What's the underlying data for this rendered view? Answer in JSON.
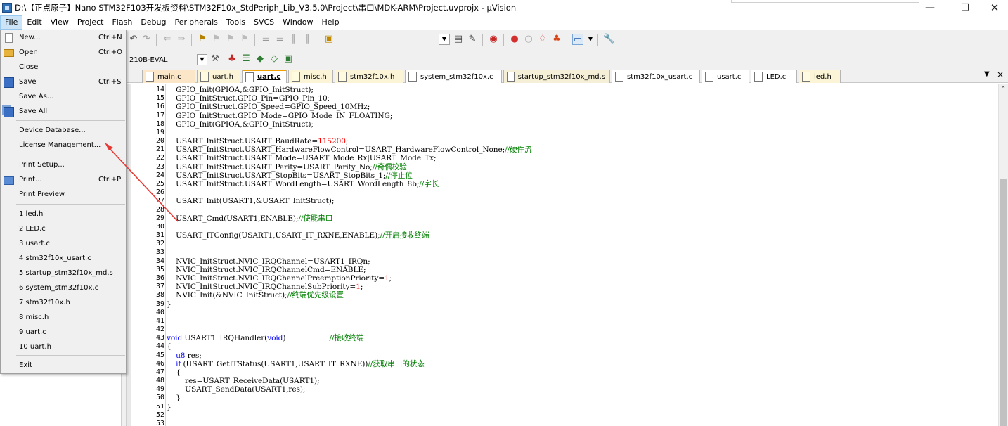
{
  "window": {
    "title": "D:\\【正点原子】Nano STM32F103开发板资料\\STM32F10x_StdPeriph_Lib_V3.5.0\\Project\\串口\\MDK-ARM\\Project.uvprojx - µVision",
    "minimize_glyph": "—",
    "maximize_glyph": "❐",
    "close_glyph": "✕"
  },
  "menubar": {
    "items": [
      "File",
      "Edit",
      "View",
      "Project",
      "Flash",
      "Debug",
      "Peripherals",
      "Tools",
      "SVCS",
      "Window",
      "Help"
    ]
  },
  "file_menu": {
    "items": [
      {
        "label": "New...",
        "shortcut": "Ctrl+N",
        "icon": "new-file-icon"
      },
      {
        "label": "Open",
        "shortcut": "Ctrl+O",
        "icon": "open-folder-icon"
      },
      {
        "label": "Close",
        "shortcut": "",
        "icon": ""
      },
      {
        "label": "Save",
        "shortcut": "Ctrl+S",
        "icon": "save-icon"
      },
      {
        "label": "Save As...",
        "shortcut": "",
        "icon": ""
      },
      {
        "label": "Save All",
        "shortcut": "",
        "icon": "save-all-icon"
      },
      {
        "label": "Device Database...",
        "shortcut": "",
        "icon": ""
      },
      {
        "label": "License Management...",
        "shortcut": "",
        "icon": ""
      },
      {
        "label": "Print Setup...",
        "shortcut": "",
        "icon": ""
      },
      {
        "label": "Print...",
        "shortcut": "Ctrl+P",
        "icon": "print-icon"
      },
      {
        "label": "Print Preview",
        "shortcut": "",
        "icon": ""
      },
      {
        "label": "1 led.h",
        "shortcut": "",
        "icon": ""
      },
      {
        "label": "2 LED.c",
        "shortcut": "",
        "icon": ""
      },
      {
        "label": "3 usart.c",
        "shortcut": "",
        "icon": ""
      },
      {
        "label": "4 stm32f10x_usart.c",
        "shortcut": "",
        "icon": ""
      },
      {
        "label": "5 startup_stm32f10x_md.s",
        "shortcut": "",
        "icon": ""
      },
      {
        "label": "6 system_stm32f10x.c",
        "shortcut": "",
        "icon": ""
      },
      {
        "label": "7 stm32f10x.h",
        "shortcut": "",
        "icon": ""
      },
      {
        "label": "8 misc.h",
        "shortcut": "",
        "icon": ""
      },
      {
        "label": "9 uart.c",
        "shortcut": "",
        "icon": ""
      },
      {
        "label": "10 uart.h",
        "shortcut": "",
        "icon": ""
      },
      {
        "label": "Exit",
        "shortcut": "",
        "icon": ""
      }
    ]
  },
  "toolbar": {
    "target": "210B-EVAL"
  },
  "tabs": [
    {
      "label": "main.c",
      "active": false
    },
    {
      "label": "uart.h",
      "active": false
    },
    {
      "label": "uart.c",
      "active": true
    },
    {
      "label": "misc.h",
      "active": false
    },
    {
      "label": "stm32f10x.h",
      "active": false
    },
    {
      "label": "system_stm32f10x.c",
      "active": false
    },
    {
      "label": "startup_stm32f10x_md.s",
      "active": false
    },
    {
      "label": "stm32f10x_usart.c",
      "active": false
    },
    {
      "label": "usart.c",
      "active": false
    },
    {
      "label": "LED.c",
      "active": false
    },
    {
      "label": "led.h",
      "active": false
    }
  ],
  "tabs_menu_glyph": "▼",
  "tabs_close_glyph": "×",
  "left_panel": {
    "fragments": [
      "/",
      "/"
    ]
  },
  "code": {
    "lines": [
      {
        "n": "14",
        "fold": "",
        "parts": [
          [
            "",
            "    GPIO_Init(GPIOA,&GPIO_InitStruct);"
          ]
        ]
      },
      {
        "n": "15",
        "fold": "",
        "parts": [
          [
            "",
            "    GPIO_InitStruct.GPIO_Pin=GPIO_Pin_10;"
          ]
        ]
      },
      {
        "n": "16",
        "fold": "",
        "parts": [
          [
            "",
            "    GPIO_InitStruct.GPIO_Speed=GPIO_Speed_10MHz;"
          ]
        ]
      },
      {
        "n": "17",
        "fold": "",
        "parts": [
          [
            "",
            "    GPIO_InitStruct.GPIO_Mode=GPIO_Mode_IN_FLOATING;"
          ]
        ]
      },
      {
        "n": "18",
        "fold": "",
        "parts": [
          [
            "",
            "    GPIO_Init(GPIOA,&GPIO_InitStruct);"
          ]
        ]
      },
      {
        "n": "19",
        "fold": "",
        "parts": [
          [
            "",
            ""
          ]
        ]
      },
      {
        "n": "20",
        "fold": "",
        "parts": [
          [
            "",
            "    USART_InitStruct.USART_BaudRate="
          ],
          [
            "num",
            "115200"
          ],
          [
            "",
            ";"
          ]
        ]
      },
      {
        "n": "21",
        "fold": "",
        "parts": [
          [
            "",
            "    USART_InitStruct.USART_HardwareFlowControl=USART_HardwareFlowControl_None;"
          ],
          [
            "cm",
            "//硬件流"
          ]
        ]
      },
      {
        "n": "22",
        "fold": "",
        "parts": [
          [
            "",
            "    USART_InitStruct.USART_Mode=USART_Mode_Rx|USART_Mode_Tx;"
          ]
        ]
      },
      {
        "n": "23",
        "fold": "",
        "parts": [
          [
            "",
            "    USART_InitStruct.USART_Parity=USART_Parity_No;"
          ],
          [
            "cm",
            "//奇偶校验"
          ]
        ]
      },
      {
        "n": "24",
        "fold": "",
        "parts": [
          [
            "",
            "    USART_InitStruct.USART_StopBits=USART_StopBits_1;"
          ],
          [
            "cm",
            "//停止位"
          ]
        ]
      },
      {
        "n": "25",
        "fold": "",
        "parts": [
          [
            "",
            "    USART_InitStruct.USART_WordLength=USART_WordLength_8b;"
          ],
          [
            "cm",
            "//字长"
          ]
        ]
      },
      {
        "n": "26",
        "fold": "",
        "parts": [
          [
            "",
            ""
          ]
        ]
      },
      {
        "n": "27",
        "fold": "",
        "parts": [
          [
            "",
            "    USART_Init(USART1,&USART_InitStruct);"
          ]
        ]
      },
      {
        "n": "28",
        "fold": "",
        "parts": [
          [
            "",
            ""
          ]
        ]
      },
      {
        "n": "29",
        "fold": "",
        "parts": [
          [
            "",
            "    USART_Cmd(USART1,ENABLE);"
          ],
          [
            "cm",
            "//使能串口"
          ]
        ]
      },
      {
        "n": "30",
        "fold": "",
        "parts": [
          [
            "",
            ""
          ]
        ]
      },
      {
        "n": "31",
        "fold": "",
        "parts": [
          [
            "",
            "    USART_ITConfig(USART1,USART_IT_RXNE,ENABLE);"
          ],
          [
            "cm",
            "//开启接收终端"
          ]
        ]
      },
      {
        "n": "32",
        "fold": "",
        "parts": [
          [
            "",
            ""
          ]
        ]
      },
      {
        "n": "33",
        "fold": "",
        "parts": [
          [
            "",
            ""
          ]
        ]
      },
      {
        "n": "34",
        "fold": "",
        "parts": [
          [
            "",
            "    NVIC_InitStruct.NVIC_IRQChannel=USART1_IRQn;"
          ]
        ]
      },
      {
        "n": "35",
        "fold": "",
        "parts": [
          [
            "",
            "    NVIC_InitStruct.NVIC_IRQChannelCmd=ENABLE;"
          ]
        ]
      },
      {
        "n": "36",
        "fold": "",
        "parts": [
          [
            "",
            "    NVIC_InitStruct.NVIC_IRQChannelPreemptionPriority="
          ],
          [
            "num",
            "1"
          ],
          [
            "",
            ";"
          ]
        ]
      },
      {
        "n": "37",
        "fold": "",
        "parts": [
          [
            "",
            "    NVIC_InitStruct.NVIC_IRQChannelSubPriority="
          ],
          [
            "num",
            "1"
          ],
          [
            "",
            ";"
          ]
        ]
      },
      {
        "n": "38",
        "fold": "",
        "parts": [
          [
            "",
            "    NVIC_Init(&NVIC_InitStruct);"
          ],
          [
            "cm",
            "//终端优先级设置"
          ]
        ]
      },
      {
        "n": "39",
        "fold": "",
        "parts": [
          [
            "",
            "}"
          ]
        ]
      },
      {
        "n": "40",
        "fold": "",
        "parts": [
          [
            "",
            ""
          ]
        ]
      },
      {
        "n": "41",
        "fold": "",
        "parts": [
          [
            "",
            ""
          ]
        ]
      },
      {
        "n": "42",
        "fold": "",
        "parts": [
          [
            "",
            ""
          ]
        ]
      },
      {
        "n": "43",
        "fold": "",
        "parts": [
          [
            "kw",
            "void"
          ],
          [
            "",
            " USART1_IRQHandler("
          ],
          [
            "kw",
            "void"
          ],
          [
            "",
            ")                   "
          ],
          [
            "cm",
            "//接收终端"
          ]
        ]
      },
      {
        "n": "44",
        "fold": "",
        "parts": [
          [
            "",
            "{"
          ]
        ]
      },
      {
        "n": "45",
        "fold": "",
        "parts": [
          [
            "",
            "    "
          ],
          [
            "kw",
            "u8"
          ],
          [
            "",
            " res;"
          ]
        ]
      },
      {
        "n": "46",
        "fold": "",
        "parts": [
          [
            "",
            "    "
          ],
          [
            "kw",
            "if"
          ],
          [
            "",
            " (USART_GetITStatus(USART1,USART_IT_RXNE))"
          ],
          [
            "cm",
            "//获取串口的状态"
          ]
        ]
      },
      {
        "n": "47",
        "fold": "",
        "parts": [
          [
            "",
            "    {"
          ]
        ]
      },
      {
        "n": "48",
        "fold": "",
        "parts": [
          [
            "",
            "        res=USART_ReceiveData(USART1);"
          ]
        ]
      },
      {
        "n": "49",
        "fold": "",
        "parts": [
          [
            "",
            "        USART_SendData(USART1,res);"
          ]
        ]
      },
      {
        "n": "50",
        "fold": "",
        "parts": [
          [
            "",
            "    }"
          ]
        ]
      },
      {
        "n": "51",
        "fold": "",
        "parts": [
          [
            "",
            "}"
          ]
        ]
      },
      {
        "n": "52",
        "fold": "",
        "parts": [
          [
            "",
            ""
          ]
        ]
      },
      {
        "n": "53",
        "fold": "",
        "parts": [
          [
            "",
            ""
          ]
        ]
      }
    ]
  },
  "colors": {
    "keyword": "#0000ff",
    "comment": "#008000",
    "number": "#ff0000",
    "annotation_arrow": "#e53935"
  }
}
